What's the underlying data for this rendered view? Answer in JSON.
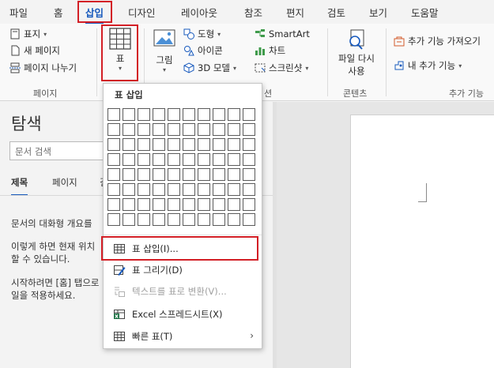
{
  "tabs": [
    "파일",
    "홈",
    "삽입",
    "디자인",
    "레이아웃",
    "참조",
    "편지",
    "검토",
    "보기",
    "도움말"
  ],
  "ribbon": {
    "pages_group": {
      "cover_page": "표지",
      "blank_page": "새 페이지",
      "page_break": "페이지 나누기",
      "label": "페이지"
    },
    "table_button": "표",
    "picture_button": "그림",
    "shapes": "도형",
    "icons": "아이콘",
    "models_3d": "3D 모델",
    "smartart": "SmartArt",
    "chart": "차트",
    "screenshot": "스크린샷",
    "illustrations_label_partial": "션",
    "get_file": {
      "line1": "파일 다시",
      "line2": "사용"
    },
    "content_label": "콘텐츠",
    "get_addins": "추가 기능 가져오기",
    "my_addins": "내 추가 기능",
    "addins_label": "추가 기능"
  },
  "nav": {
    "title": "탐색",
    "close": "×",
    "search_placeholder": "문서 검색",
    "tabs": [
      "제목",
      "페이지",
      "결"
    ],
    "text1": "문서의 대화형 개요를",
    "text2a": "이렇게 하면 현재 위치",
    "text2b": "할 수 있습니다.",
    "text3a": "시작하려면 [홈] 탭으로",
    "text3b": "일을 적용하세요."
  },
  "menu": {
    "header": "표 삽입",
    "grid_cols": 10,
    "grid_rows": 8,
    "items": [
      {
        "label": "표 삽입(I)...",
        "enabled": true
      },
      {
        "label": "표 그리기(D)",
        "enabled": true
      },
      {
        "label": "텍스트를 표로 변환(V)...",
        "enabled": false
      },
      {
        "label": "Excel 스프레드시트(X)",
        "enabled": true
      },
      {
        "label": "빠른 표(T)",
        "enabled": true,
        "submenu": true
      }
    ]
  },
  "colors": {
    "highlight": "#d31f26",
    "accent": "#185abd",
    "excel": "#1e7145"
  }
}
